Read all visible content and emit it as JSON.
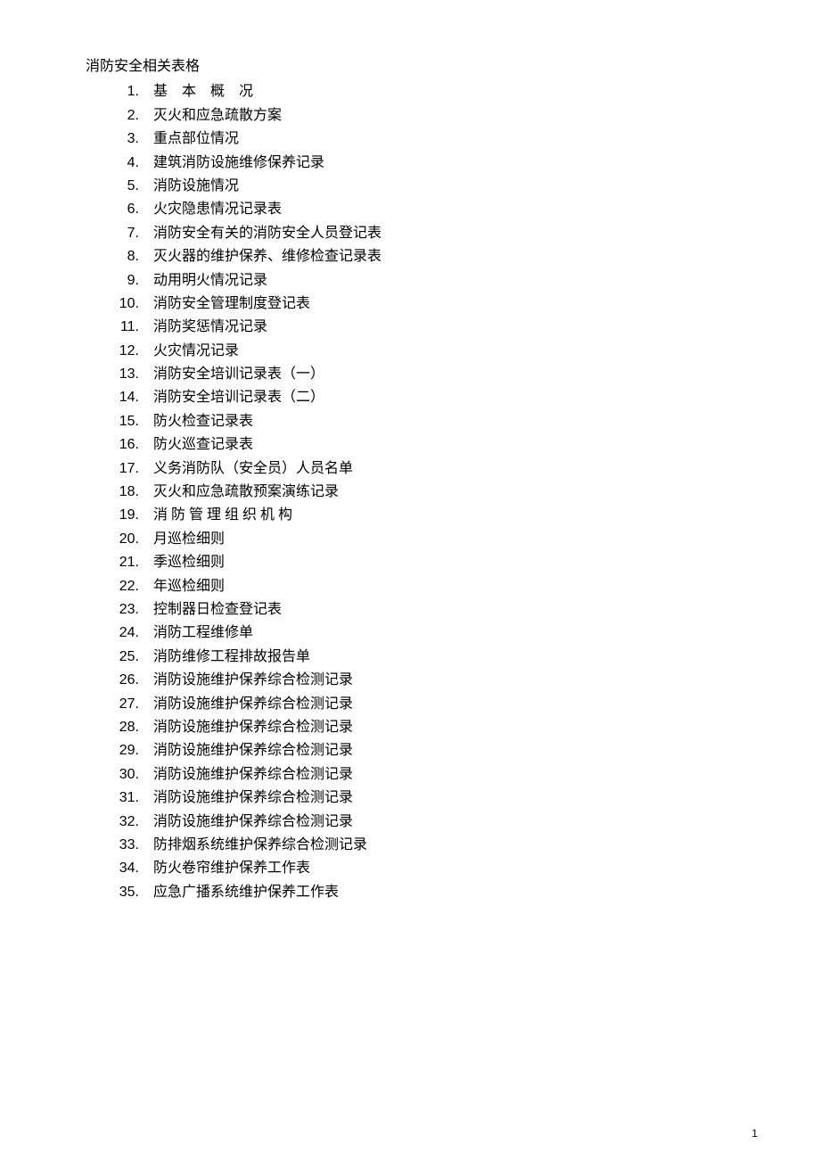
{
  "title": "消防安全相关表格",
  "items": [
    {
      "num": "1.",
      "text": "基 本 概 况"
    },
    {
      "num": "2.",
      "text": "灭火和应急疏散方案"
    },
    {
      "num": "3.",
      "text": "重点部位情况"
    },
    {
      "num": "4.",
      "text": "建筑消防设施维修保养记录"
    },
    {
      "num": "5.",
      "text": "消防设施情况"
    },
    {
      "num": "6.",
      "text": "火灾隐患情况记录表"
    },
    {
      "num": "7.",
      "text": "消防安全有关的消防安全人员登记表"
    },
    {
      "num": "8.",
      "text": "灭火器的维护保养、维修检查记录表"
    },
    {
      "num": "9.",
      "text": "动用明火情况记录"
    },
    {
      "num": "10.",
      "text": "消防安全管理制度登记表"
    },
    {
      "num": "11.",
      "text": "消防奖惩情况记录"
    },
    {
      "num": "12.",
      "text": "火灾情况记录"
    },
    {
      "num": "13.",
      "text": "消防安全培训记录表（一）"
    },
    {
      "num": "14.",
      "text": "消防安全培训记录表（二）"
    },
    {
      "num": "15.",
      "text": "防火检查记录表"
    },
    {
      "num": "16.",
      "text": "防火巡查记录表"
    },
    {
      "num": "17.",
      "text": "义务消防队（安全员）人员名单"
    },
    {
      "num": "18.",
      "text": "灭火和应急疏散预案演练记录"
    },
    {
      "num": "19.",
      "text": "消 防 管 理 组 织 机 构"
    },
    {
      "num": "20.",
      "text": "月巡检细则"
    },
    {
      "num": "21.",
      "text": "季巡检细则"
    },
    {
      "num": "22.",
      "text": "年巡检细则"
    },
    {
      "num": "23.",
      "text": "控制器日检查登记表"
    },
    {
      "num": "24.",
      "text": "消防工程维修单"
    },
    {
      "num": "25.",
      "text": "消防维修工程排故报告单"
    },
    {
      "num": "26.",
      "text": "消防设施维护保养综合检测记录"
    },
    {
      "num": "27.",
      "text": "消防设施维护保养综合检测记录"
    },
    {
      "num": "28.",
      "text": "消防设施维护保养综合检测记录"
    },
    {
      "num": "29.",
      "text": "消防设施维护保养综合检测记录"
    },
    {
      "num": "30.",
      "text": "消防设施维护保养综合检测记录"
    },
    {
      "num": "31.",
      "text": "消防设施维护保养综合检测记录"
    },
    {
      "num": "32.",
      "text": "消防设施维护保养综合检测记录"
    },
    {
      "num": "33.",
      "text": "防排烟系统维护保养综合检测记录"
    },
    {
      "num": "34.",
      "text": "防火卷帘维护保养工作表"
    },
    {
      "num": "35.",
      "text": "应急广播系统维护保养工作表"
    }
  ],
  "pageNumber": "1"
}
